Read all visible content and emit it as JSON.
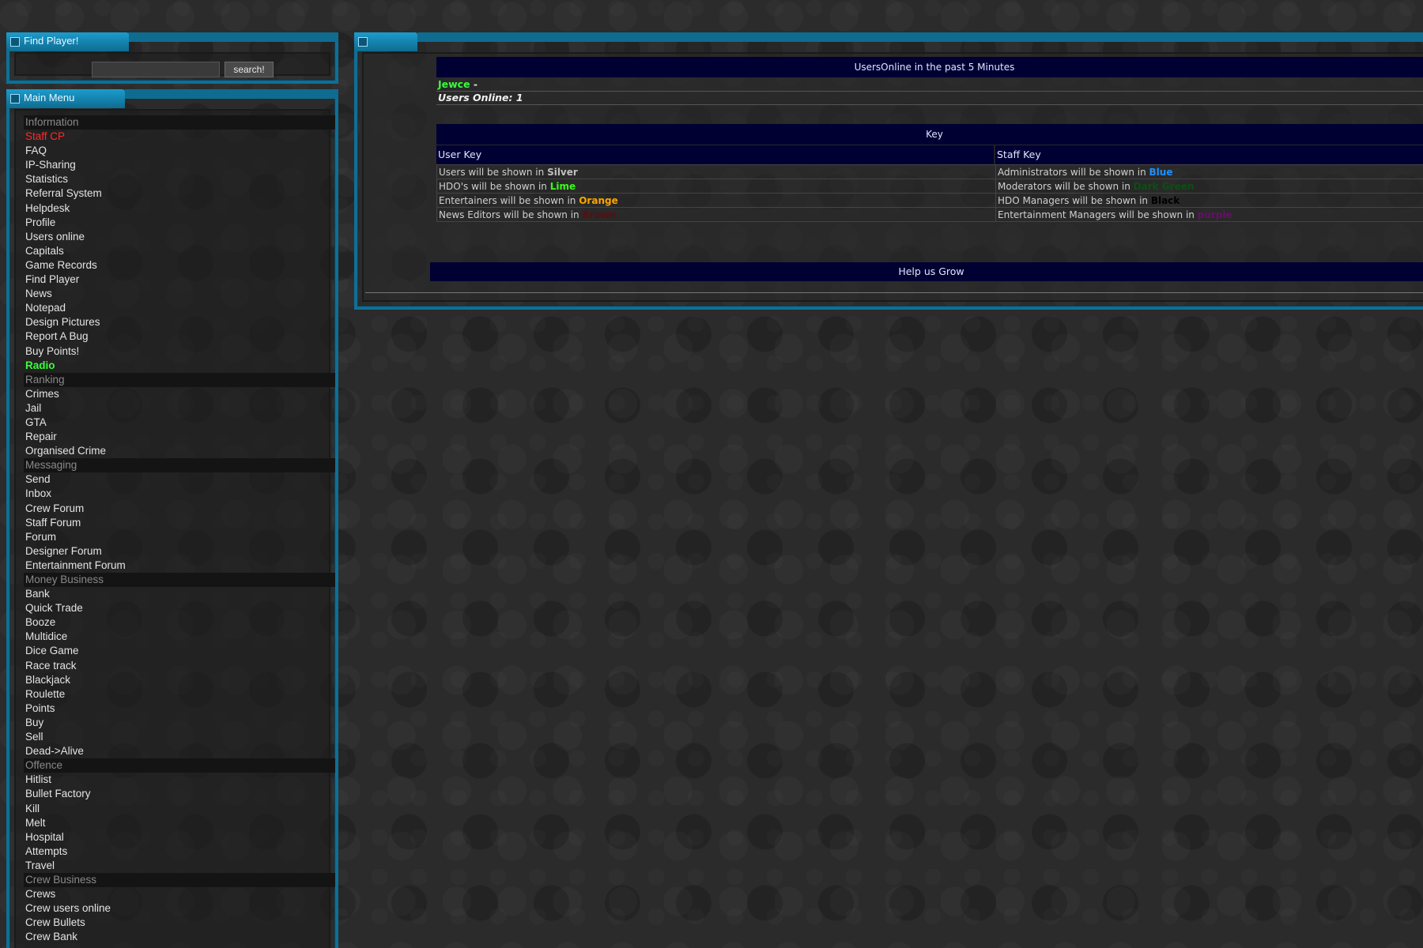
{
  "find_player": {
    "title": "Find Player!",
    "input_value": "",
    "search_label": "search!"
  },
  "main_menu": {
    "title": "Main Menu",
    "items": [
      {
        "label": "Information",
        "kind": "section"
      },
      {
        "label": "Staff CP",
        "kind": "red"
      },
      {
        "label": "FAQ",
        "kind": "link"
      },
      {
        "label": "IP-Sharing",
        "kind": "link"
      },
      {
        "label": "Statistics",
        "kind": "link"
      },
      {
        "label": "Referral System",
        "kind": "link"
      },
      {
        "label": "Helpdesk",
        "kind": "link"
      },
      {
        "label": "Profile",
        "kind": "link"
      },
      {
        "label": "Users online",
        "kind": "link"
      },
      {
        "label": "Capitals",
        "kind": "link"
      },
      {
        "label": "Game Records",
        "kind": "link"
      },
      {
        "label": "Find Player",
        "kind": "link"
      },
      {
        "label": "News",
        "kind": "link"
      },
      {
        "label": "Notepad",
        "kind": "link"
      },
      {
        "label": "Design Pictures",
        "kind": "link"
      },
      {
        "label": "Report A Bug",
        "kind": "link"
      },
      {
        "label": "Buy Points!",
        "kind": "link"
      },
      {
        "label": "Radio",
        "kind": "green"
      },
      {
        "label": "Ranking",
        "kind": "section"
      },
      {
        "label": "Crimes",
        "kind": "link"
      },
      {
        "label": "Jail",
        "kind": "link"
      },
      {
        "label": "GTA",
        "kind": "link"
      },
      {
        "label": "Repair",
        "kind": "link"
      },
      {
        "label": "Organised Crime",
        "kind": "link"
      },
      {
        "label": "Messaging",
        "kind": "section"
      },
      {
        "label": "Send",
        "kind": "link"
      },
      {
        "label": "Inbox",
        "kind": "link"
      },
      {
        "label": "Crew Forum",
        "kind": "link"
      },
      {
        "label": "Staff Forum",
        "kind": "link"
      },
      {
        "label": "Forum",
        "kind": "link"
      },
      {
        "label": "Designer Forum",
        "kind": "link"
      },
      {
        "label": "Entertainment Forum",
        "kind": "link"
      },
      {
        "label": "Money Business",
        "kind": "section"
      },
      {
        "label": "Bank",
        "kind": "link"
      },
      {
        "label": "Quick Trade",
        "kind": "link"
      },
      {
        "label": "Booze",
        "kind": "link"
      },
      {
        "label": "Multidice",
        "kind": "link"
      },
      {
        "label": "Dice Game",
        "kind": "link"
      },
      {
        "label": "Race track",
        "kind": "link"
      },
      {
        "label": "Blackjack",
        "kind": "link"
      },
      {
        "label": "Roulette",
        "kind": "link"
      },
      {
        "label": "Points",
        "kind": "link"
      },
      {
        "label": "Buy",
        "kind": "link"
      },
      {
        "label": "Sell",
        "kind": "link"
      },
      {
        "label": "Dead->Alive",
        "kind": "link"
      },
      {
        "label": "Offence",
        "kind": "section"
      },
      {
        "label": "Hitlist",
        "kind": "link"
      },
      {
        "label": "Bullet Factory",
        "kind": "link"
      },
      {
        "label": "Kill",
        "kind": "link"
      },
      {
        "label": "Melt",
        "kind": "link"
      },
      {
        "label": "Hospital",
        "kind": "link"
      },
      {
        "label": "Attempts",
        "kind": "link"
      },
      {
        "label": "Travel",
        "kind": "link"
      },
      {
        "label": "Crew Business",
        "kind": "section"
      },
      {
        "label": "Crews",
        "kind": "link"
      },
      {
        "label": "Crew users online",
        "kind": "link"
      },
      {
        "label": "Crew Bullets",
        "kind": "link"
      },
      {
        "label": "Crew Bank",
        "kind": "link"
      }
    ]
  },
  "users_online": {
    "title": "UsersOnline in the past 5 Minutes",
    "user": "Jewce",
    "separator": " -",
    "count_label": "Users Online: 1"
  },
  "key": {
    "title": "Key",
    "user_key_header": "User Key",
    "staff_key_header": "Staff Key",
    "rows": [
      {
        "user_text": "Users will be shown in ",
        "user_color_name": "Silver",
        "user_color": "#c0c0c0",
        "staff_text": "Administrators will be shown in ",
        "staff_color_name": "Blue",
        "staff_color": "#1e90ff"
      },
      {
        "user_text": "HDO's will be shown in ",
        "user_color_name": "Lime",
        "user_color": "#39ff14",
        "staff_text": "Moderators will be shown in ",
        "staff_color_name": "Dark Green",
        "staff_color": "#0b4f12"
      },
      {
        "user_text": "Entertainers will be shown in ",
        "user_color_name": "Orange",
        "user_color": "#ffa500",
        "staff_text": "HDO Managers will be shown in ",
        "staff_color_name": "Black",
        "staff_color": "#000000"
      },
      {
        "user_text": "News Editors will be shown in ",
        "user_color_name": "Brown",
        "user_color": "#5a0e0e",
        "staff_text": "Entertainment Managers will be shown in ",
        "staff_color_name": "purple",
        "staff_color": "#6a0d6a"
      }
    ]
  },
  "help_bar": "Help us Grow",
  "colors": {
    "frame": "#0f6f96",
    "header_bar": "#000033",
    "online_user": "#39ff39"
  }
}
